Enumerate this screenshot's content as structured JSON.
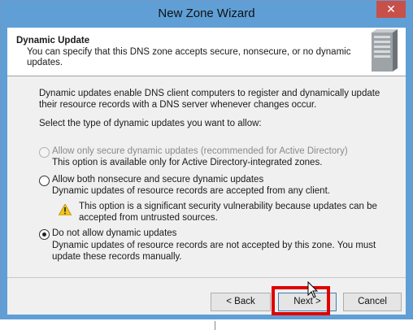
{
  "window": {
    "title": "New Zone Wizard",
    "close_label": "✕"
  },
  "header": {
    "title": "Dynamic Update",
    "description": "You can specify that this DNS zone accepts secure, nonsecure, or no dynamic updates."
  },
  "body": {
    "intro": "Dynamic updates enable DNS client computers to register and dynamically update their resource records with a DNS server whenever changes occur.",
    "select_prompt": "Select the type of dynamic updates you want to allow:",
    "options": [
      {
        "label": "Allow only secure dynamic updates (recommended for Active Directory)",
        "description": "This option is available only for Active Directory-integrated zones.",
        "enabled": false,
        "selected": false
      },
      {
        "label": "Allow both nonsecure and secure dynamic updates",
        "description": "Dynamic updates of resource records are accepted from any client.",
        "enabled": true,
        "selected": false
      },
      {
        "label": "Do not allow dynamic updates",
        "description": "Dynamic updates of resource records are not accepted by this zone. You must update these records manually.",
        "enabled": true,
        "selected": true
      }
    ],
    "warning": "This option is a significant security vulnerability because updates can be accepted from untrusted sources."
  },
  "buttons": {
    "back": "< Back",
    "next": "Next >",
    "cancel": "Cancel"
  },
  "icons": {
    "header": "server-icon",
    "warning": "warning-icon",
    "cursor": "mouse-pointer-icon"
  },
  "colors": {
    "titlebar": "#5f9fd6",
    "close_button": "#c7504a",
    "highlight": "#e00000"
  }
}
